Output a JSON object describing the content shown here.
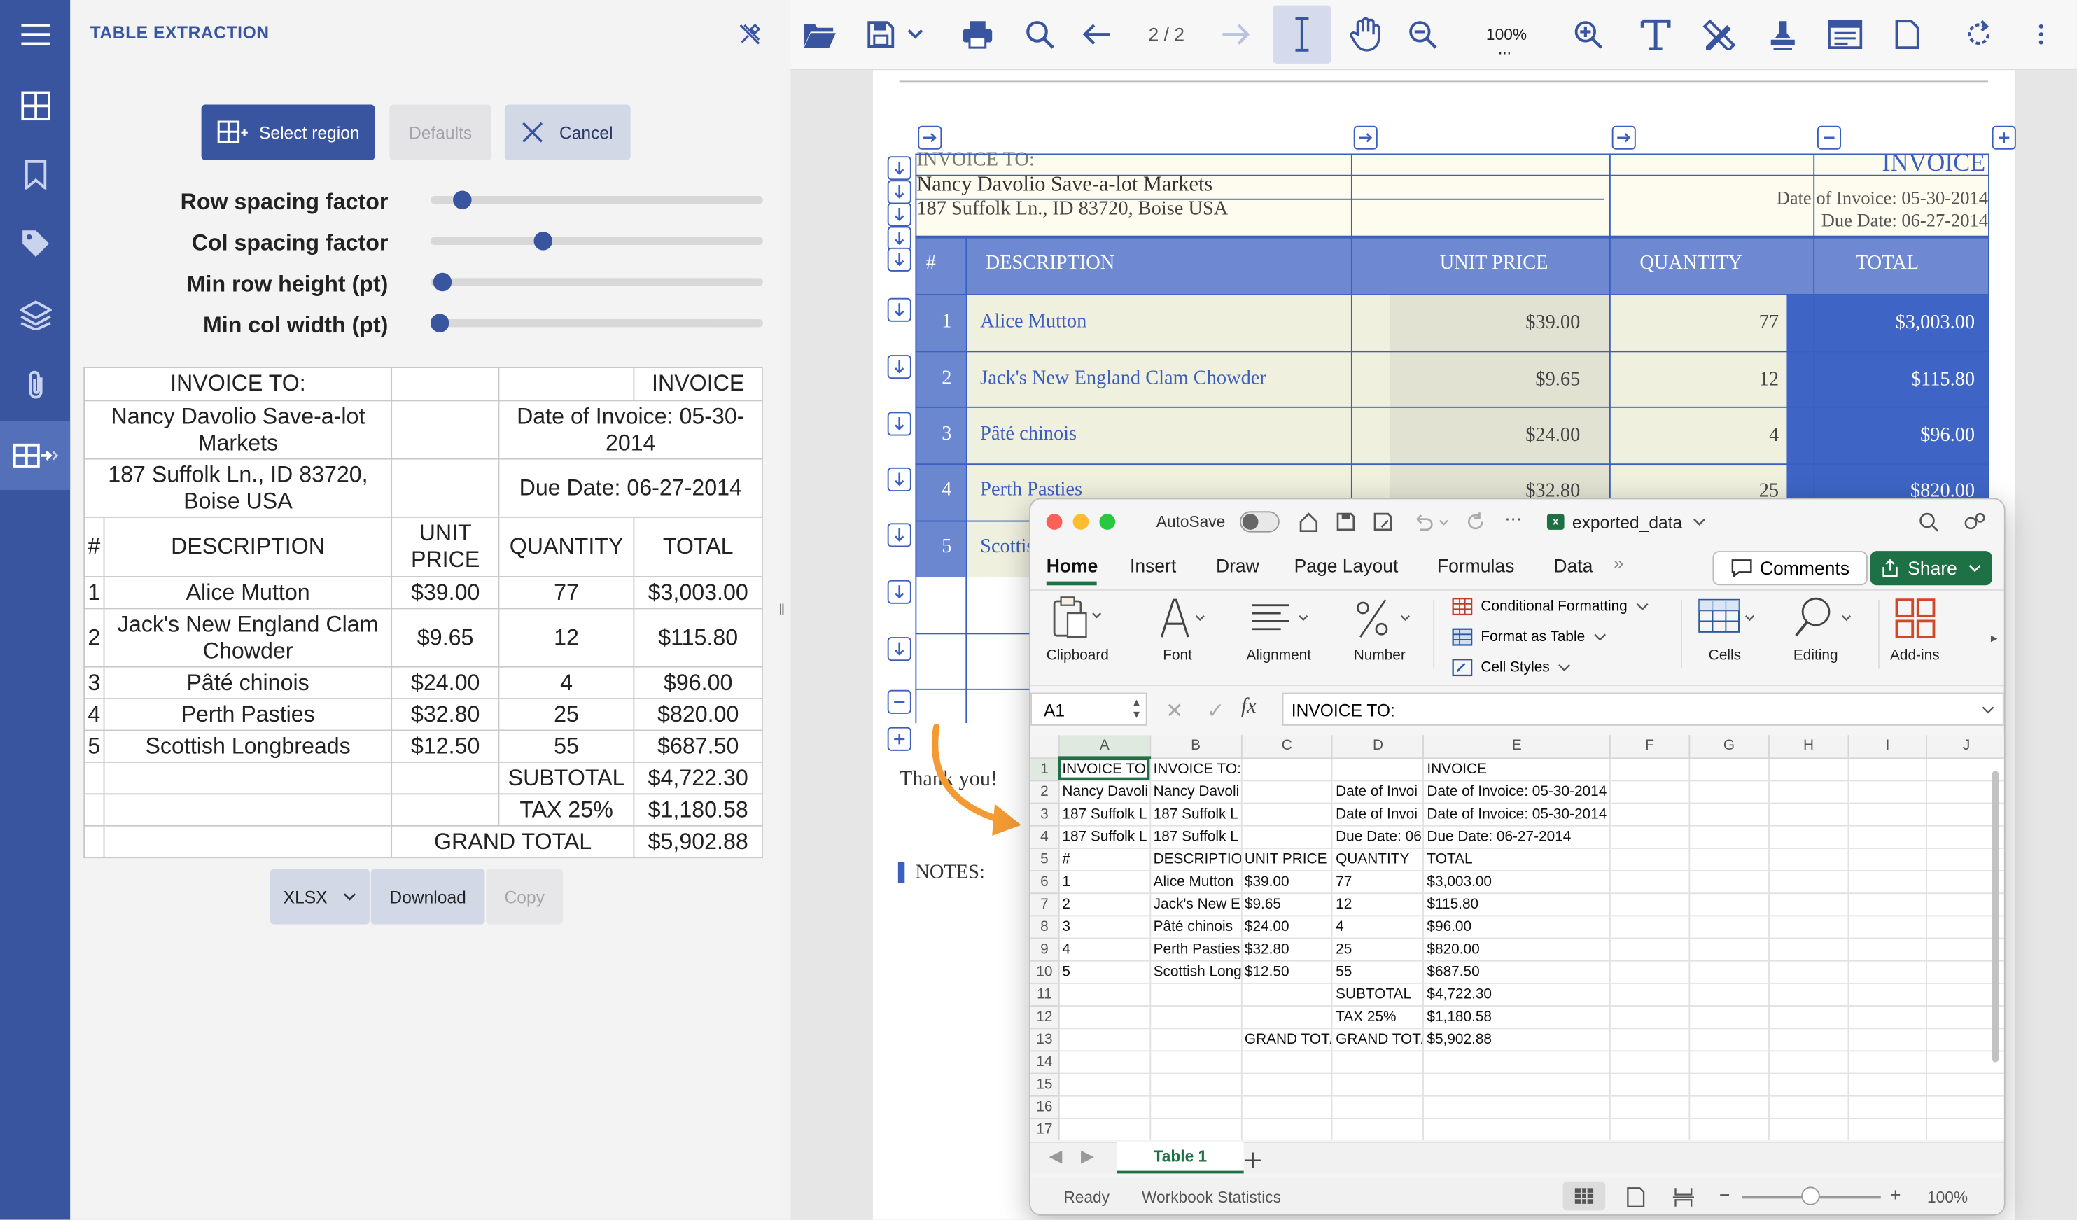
{
  "nav": {
    "items": [
      "grid-icon",
      "bookmark-icon",
      "tag-icon",
      "layers-icon",
      "paperclip-icon",
      "table-extract-icon"
    ]
  },
  "panel": {
    "title": "TABLE EXTRACTION",
    "select_region": "Select region",
    "defaults": "Defaults",
    "cancel": "Cancel",
    "sliders": [
      {
        "label": "Row spacing factor",
        "value": 0.07
      },
      {
        "label": "Col spacing factor",
        "value": 0.33
      },
      {
        "label": "Min row height (pt)",
        "value": 0.01
      },
      {
        "label": "Min col width (pt)",
        "value": 0.0
      }
    ],
    "table": {
      "r1": [
        "INVOICE TO:",
        "",
        "",
        "INVOICE"
      ],
      "r2": [
        "Nancy Davolio Save-a-lot Markets",
        "",
        "Date of Invoice: 05-30-2014"
      ],
      "r3": [
        "187 Suffolk Ln., ID 83720, Boise USA",
        "",
        "Due Date: 06-27-2014"
      ],
      "head": [
        "#",
        "DESCRIPTION",
        "UNIT PRICE",
        "QUANTITY",
        "TOTAL"
      ],
      "rows": [
        [
          "1",
          "Alice Mutton",
          "$39.00",
          "77",
          "$3,003.00"
        ],
        [
          "2",
          "Jack's New England Clam Chowder",
          "$9.65",
          "12",
          "$115.80"
        ],
        [
          "3",
          "Pâté chinois",
          "$24.00",
          "4",
          "$96.00"
        ],
        [
          "4",
          "Perth Pasties",
          "$32.80",
          "25",
          "$820.00"
        ],
        [
          "5",
          "Scottish Longbreads",
          "$12.50",
          "55",
          "$687.50"
        ]
      ],
      "subtotal": [
        "SUBTOTAL",
        "$4,722.30"
      ],
      "tax": [
        "TAX 25%",
        "$1,180.58"
      ],
      "grand": [
        "GRAND TOTAL",
        "$5,902.88"
      ]
    },
    "format": "XLSX",
    "download": "Download",
    "copy": "Copy"
  },
  "toolbar": {
    "page": "2 / 2",
    "zoom": "100%",
    "zoom_more": "..."
  },
  "doc": {
    "invoice_to": "INVOICE TO:",
    "name": "Nancy Davolio Save-a-lot Markets",
    "addr": "187 Suffolk Ln., ID 83720, Boise USA",
    "invoice": "INVOICE",
    "date": "Date of Invoice: 05-30-2014",
    "due": "Due Date: 06-27-2014",
    "head": [
      "#",
      "DESCRIPTION",
      "UNIT PRICE",
      "QUANTITY",
      "TOTAL"
    ],
    "rows": [
      [
        "1",
        "Alice Mutton",
        "$39.00",
        "77",
        "$3,003.00"
      ],
      [
        "2",
        "Jack's New England Clam Chowder",
        "$9.65",
        "12",
        "$115.80"
      ],
      [
        "3",
        "Pâté chinois",
        "$24.00",
        "4",
        "$96.00"
      ],
      [
        "4",
        "Perth Pasties",
        "$32.80",
        "25",
        "$820.00"
      ],
      [
        "5",
        "Scottis",
        "",
        "",
        ""
      ]
    ],
    "thanks": "Thank you!",
    "notes": "NOTES:"
  },
  "excel": {
    "autosave": "AutoSave",
    "filename": "exported_data",
    "tabs": [
      "Home",
      "Insert",
      "Draw",
      "Page Layout",
      "Formulas",
      "Data"
    ],
    "comments": "Comments",
    "share": "Share",
    "ribbon": {
      "clipboard": "Clipboard",
      "font": "Font",
      "alignment": "Alignment",
      "number": "Number",
      "cond": "Conditional Formatting",
      "fmt_table": "Format as Table",
      "cell_styles": "Cell Styles",
      "cells": "Cells",
      "editing": "Editing",
      "addins": "Add-ins"
    },
    "namebox": "A1",
    "formula": "INVOICE TO:",
    "cols": [
      "A",
      "B",
      "C",
      "D",
      "E",
      "F",
      "G",
      "H",
      "I",
      "J"
    ],
    "rows": [
      [
        "INVOICE TO:",
        "INVOICE TO:",
        "",
        "",
        "INVOICE"
      ],
      [
        "Nancy Davoli",
        "Nancy Davoli",
        "",
        "Date of Invoi",
        "Date of Invoice: 05-30-2014"
      ],
      [
        "187 Suffolk L",
        "187 Suffolk L",
        "",
        "Date of Invoi",
        "Date of Invoice: 05-30-2014"
      ],
      [
        "187 Suffolk L",
        "187 Suffolk L",
        "",
        "Due Date: 06",
        "Due Date: 06-27-2014"
      ],
      [
        "#",
        "DESCRIPTION",
        "UNIT PRICE",
        "QUANTITY",
        "TOTAL"
      ],
      [
        "1",
        "Alice Mutton",
        "$39.00",
        "77",
        "$3,003.00"
      ],
      [
        "2",
        "Jack's New E",
        "$9.65",
        "12",
        "$115.80"
      ],
      [
        "3",
        "Pâté chinois",
        "$24.00",
        "4",
        "$96.00"
      ],
      [
        "4",
        "Perth Pasties",
        "$32.80",
        "25",
        "$820.00"
      ],
      [
        "5",
        "Scottish Long",
        "$12.50",
        "55",
        "$687.50"
      ],
      [
        "",
        "",
        "",
        "SUBTOTAL",
        "$4,722.30"
      ],
      [
        "",
        "",
        "",
        "TAX 25%",
        "$1,180.58"
      ],
      [
        "",
        "",
        "GRAND TOT/",
        "GRAND TOT/",
        "$5,902.88"
      ],
      [
        "",
        "",
        "",
        "",
        ""
      ],
      [
        "",
        "",
        "",
        "",
        ""
      ],
      [
        "",
        "",
        "",
        "",
        ""
      ],
      [
        "",
        "",
        "",
        "",
        ""
      ]
    ],
    "sheet": "Table 1",
    "status": "Ready",
    "stats": "Workbook Statistics",
    "zoom": "100%"
  }
}
